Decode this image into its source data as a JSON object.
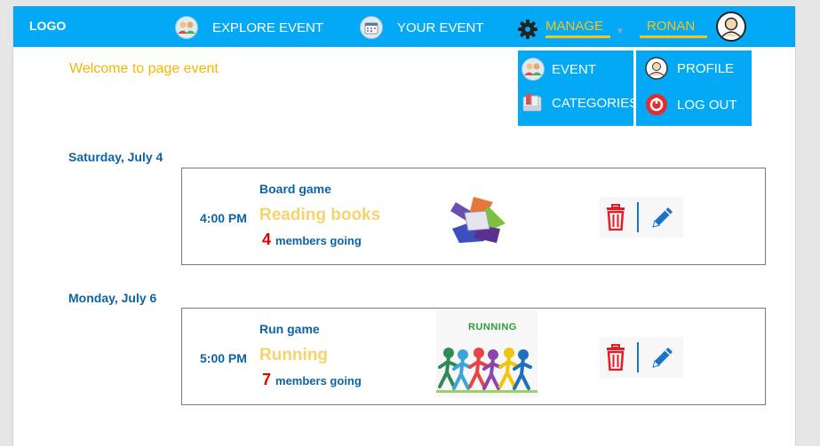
{
  "header": {
    "logo": "LOGO",
    "explore_label": "EXPLORE EVENT",
    "your_event_label": "YOUR EVENT",
    "manage_label": "MANAGE",
    "user_name": "RONAN"
  },
  "manage_menu": {
    "items": [
      {
        "label": "EVENT",
        "icon": "people-icon"
      },
      {
        "label": "CATEGORIES",
        "icon": "categories-icon"
      }
    ]
  },
  "user_menu": {
    "items": [
      {
        "label": "PROFILE",
        "icon": "profile-icon"
      },
      {
        "label": "LOG OUT",
        "icon": "power-icon"
      }
    ]
  },
  "welcome": "Welcome to page event",
  "days": [
    {
      "date": "Saturday, July 4",
      "events": [
        {
          "time": "4:00 PM",
          "category": "Board game",
          "name": "Reading books",
          "going_count": "4",
          "going_label": "members going"
        }
      ]
    },
    {
      "date": "Monday, July 6",
      "events": [
        {
          "time": "5:00 PM",
          "category": "Run game",
          "name": "Running",
          "going_count": "7",
          "going_label": "members going",
          "image_text": "RUNNING"
        }
      ]
    }
  ],
  "colors": {
    "topbar": "#03a9f4",
    "accent_yellow": "#f7c51a",
    "text_blue": "#0d63a6",
    "count_red": "#e00000"
  }
}
